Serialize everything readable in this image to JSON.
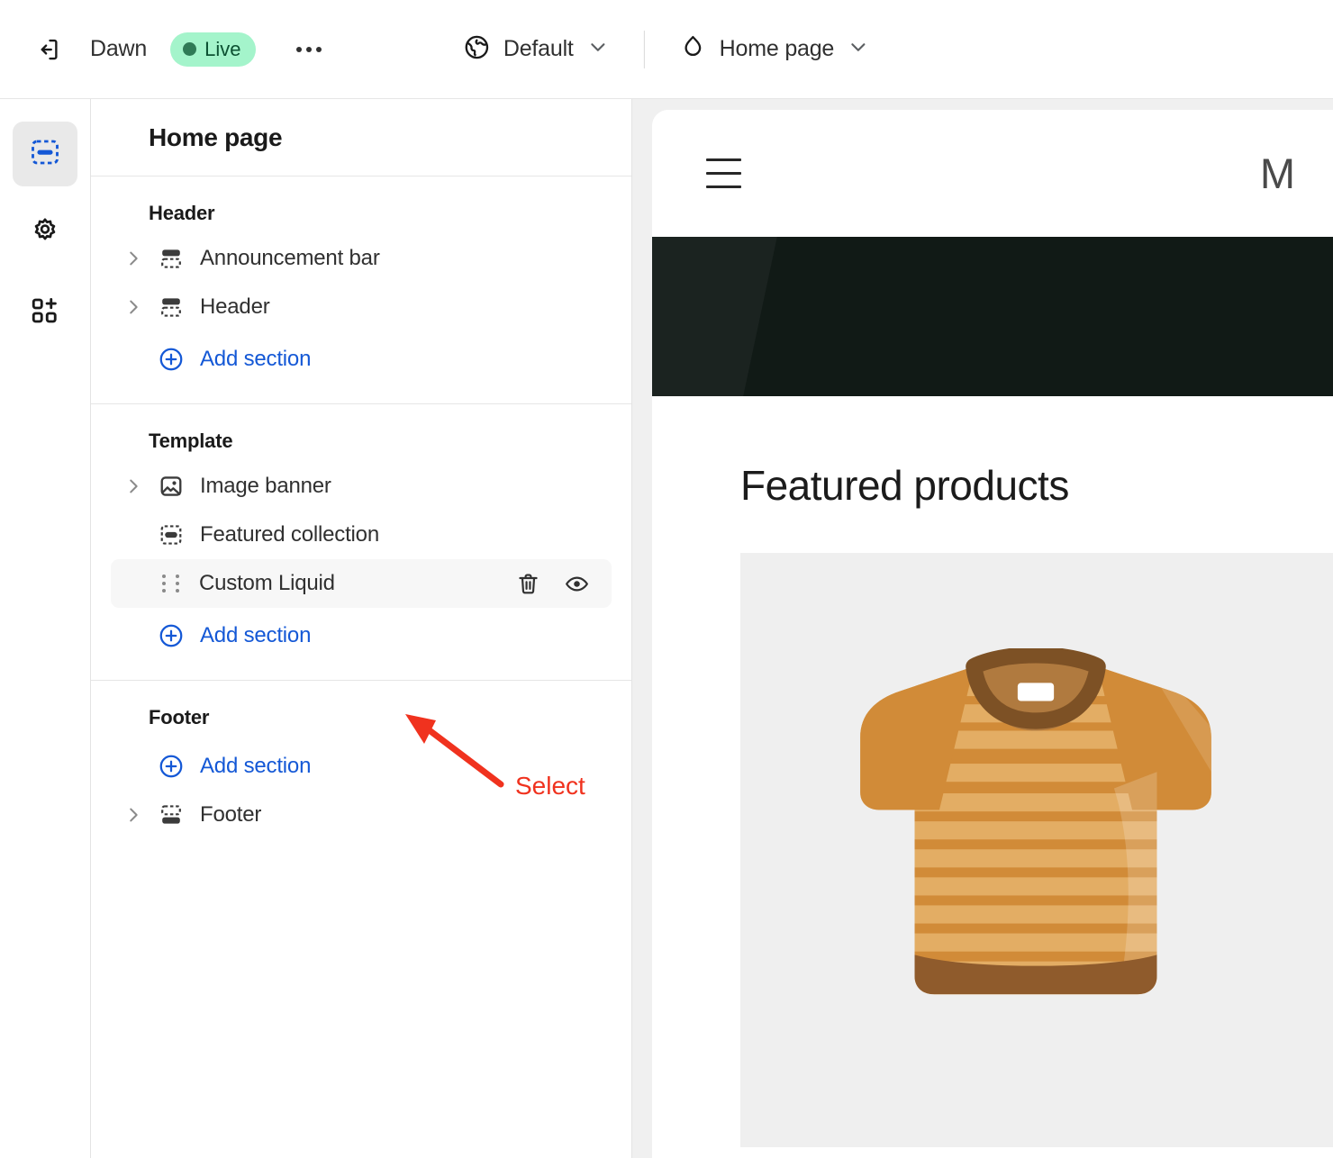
{
  "topbar": {
    "exit_icon": "exit-icon",
    "theme_name": "Dawn",
    "status_badge": "Live",
    "more_icon": "ellipsis-icon",
    "market_icon": "globe-icon",
    "market_label": "Default",
    "market_caret": "chevron-down-icon",
    "page_icon": "home-icon",
    "page_label": "Home page",
    "page_caret": "chevron-down-icon"
  },
  "rail": {
    "items": [
      {
        "name": "sections-icon",
        "label": "Sections",
        "active": true
      },
      {
        "name": "gear-icon",
        "label": "Theme settings",
        "active": false
      },
      {
        "name": "apps-icon",
        "label": "Apps",
        "active": false
      }
    ]
  },
  "sidebar": {
    "title": "Home page",
    "groups": [
      {
        "title": "Header",
        "rows": [
          {
            "label": "Announcement bar",
            "icon": "section-header-icon",
            "caret": "chevron-right-icon",
            "selected": false
          },
          {
            "label": "Header",
            "icon": "section-header-icon",
            "caret": "chevron-right-icon",
            "selected": false
          }
        ],
        "add_label": "Add section",
        "add_icon": "plus-circle-icon"
      },
      {
        "title": "Template",
        "rows": [
          {
            "label": "Image banner",
            "icon": "image-icon",
            "caret": "chevron-right-icon",
            "selected": false
          },
          {
            "label": "Featured collection",
            "icon": "section-block-icon",
            "caret": "",
            "selected": false
          },
          {
            "label": "Custom Liquid",
            "icon": "drag-handle-icon",
            "caret": "",
            "selected": true,
            "actions": [
              {
                "name": "delete-icon",
                "label": "Delete section"
              },
              {
                "name": "eye-icon",
                "label": "Hide section"
              }
            ]
          }
        ],
        "add_label": "Add section",
        "add_icon": "plus-circle-icon"
      },
      {
        "title": "Footer",
        "add_label": "Add section",
        "add_icon": "plus-circle-icon",
        "rows_after": [
          {
            "label": "Footer",
            "icon": "section-footer-icon",
            "caret": "chevron-right-icon",
            "selected": false
          }
        ]
      }
    ]
  },
  "preview": {
    "menu_icon": "hamburger-menu-icon",
    "shop_name": "M",
    "section_heading": "Featured products",
    "product_image": "tshirt-illustration"
  },
  "annotation": {
    "label": "Select",
    "color": "#f0321e",
    "arrow": "arrow-pointing-to-custom-liquid-row"
  },
  "colors": {
    "accent_link": "#1458d6",
    "badge_bg": "#a4f4cb",
    "badge_fg": "#0c5132",
    "selected_row_bg": "#f7f7f7",
    "preview_bg": "#f0f0f0",
    "hero_bg": "#111a16",
    "product_bg": "#efefef",
    "annotation_red": "#f0321e"
  }
}
